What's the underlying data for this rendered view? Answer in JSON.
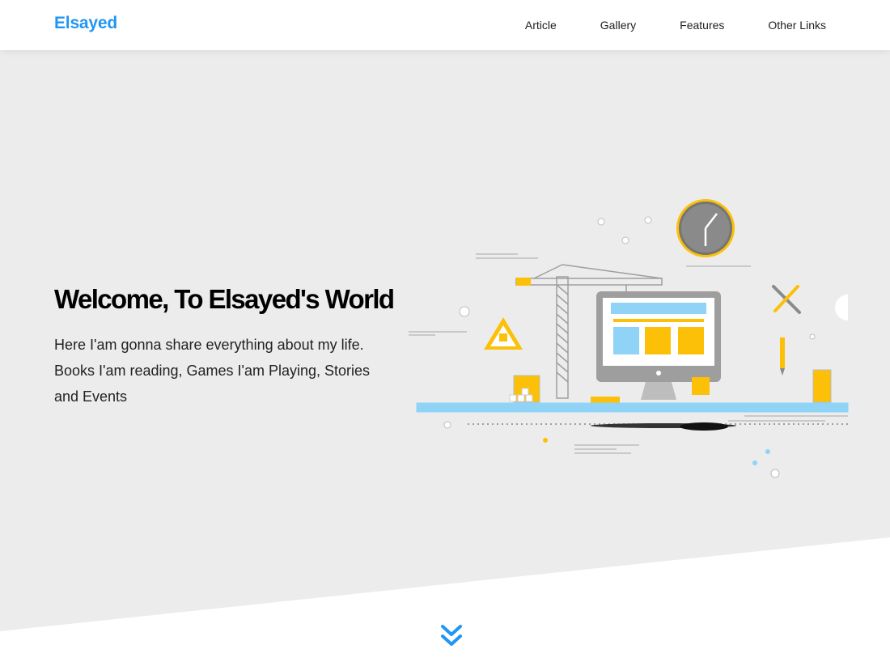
{
  "header": {
    "logo": "Elsayed",
    "nav": [
      {
        "label": "Article"
      },
      {
        "label": "Gallery"
      },
      {
        "label": "Features"
      },
      {
        "label": "Other Links"
      }
    ]
  },
  "hero": {
    "title": "Welcome, To Elsayed's World",
    "description": "Here I'am gonna share everything about my life. Books I'am reading, Games I'am Playing, Stories and Events"
  },
  "colors": {
    "accent": "#2196f3",
    "hero_background": "#ececec",
    "illustration_yellow": "#fcc008",
    "illustration_blue": "#8fd3f7"
  },
  "icons": {
    "scroll": "double-chevron-down-icon"
  }
}
